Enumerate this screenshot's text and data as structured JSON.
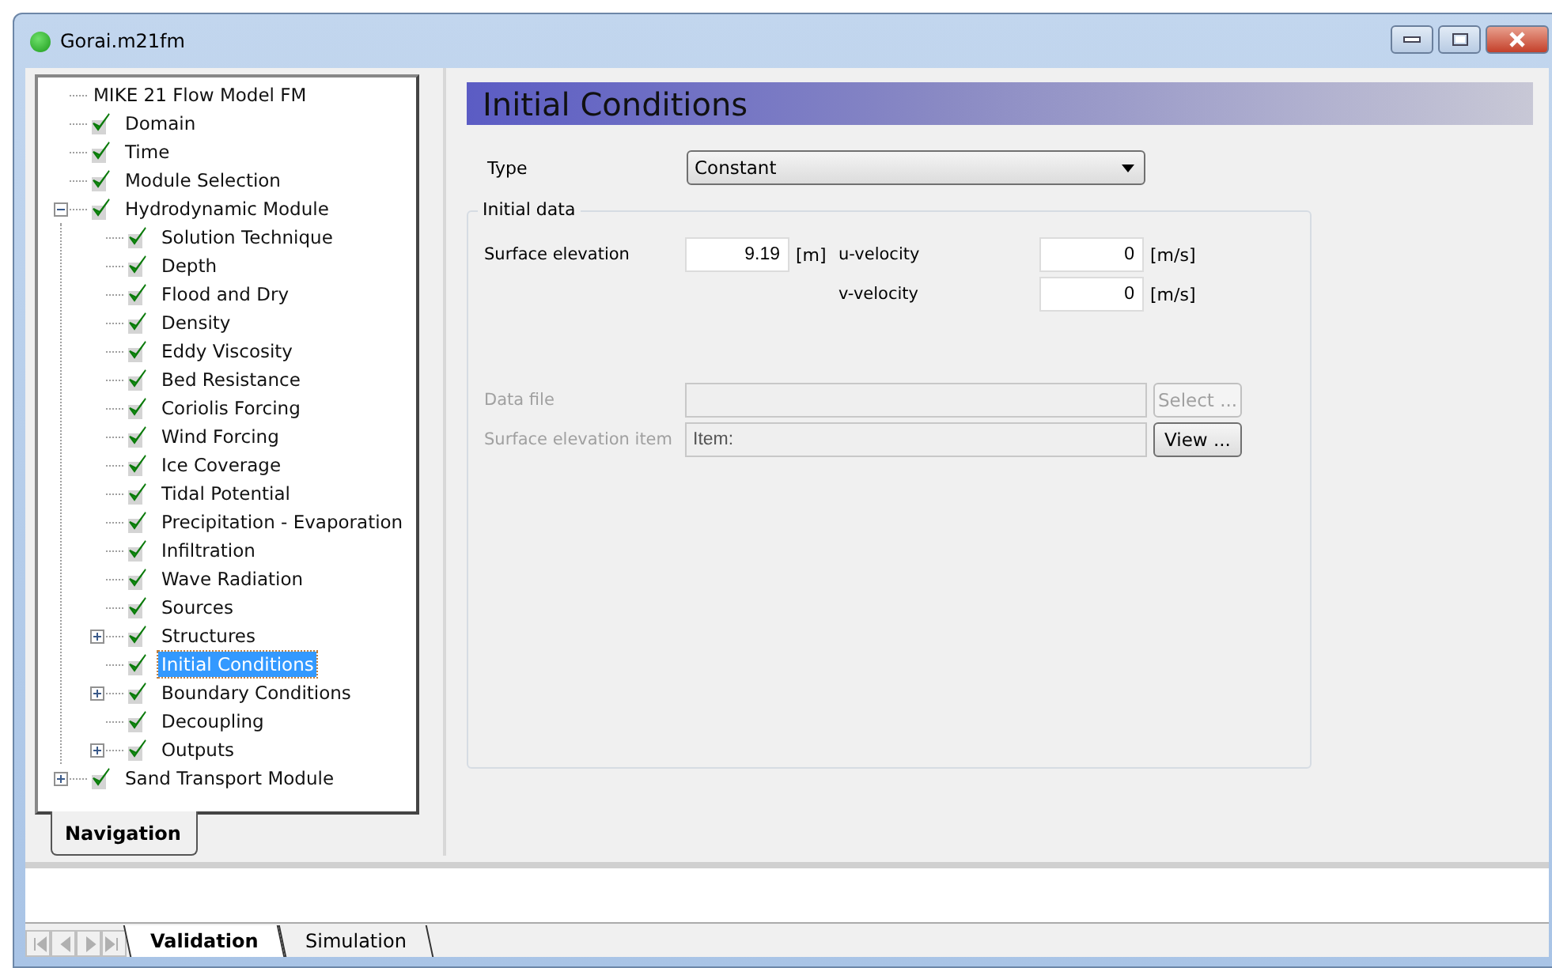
{
  "window": {
    "title": "Gorai.m21fm"
  },
  "tree": [
    {
      "label": "MIKE 21 Flow Model FM",
      "checked": false,
      "selected": false
    },
    {
      "label": "Domain",
      "checked": true,
      "selected": false
    },
    {
      "label": "Time",
      "checked": true,
      "selected": false
    },
    {
      "label": "Module Selection",
      "checked": true,
      "selected": false
    },
    {
      "label": "Hydrodynamic Module",
      "checked": true,
      "selected": false,
      "expanded": true,
      "children": [
        {
          "label": "Solution Technique",
          "checked": true,
          "selected": false
        },
        {
          "label": "Depth",
          "checked": true,
          "selected": false
        },
        {
          "label": "Flood and Dry",
          "checked": true,
          "selected": false
        },
        {
          "label": "Density",
          "checked": true,
          "selected": false
        },
        {
          "label": "Eddy Viscosity",
          "checked": true,
          "selected": false
        },
        {
          "label": "Bed Resistance",
          "checked": true,
          "selected": false
        },
        {
          "label": "Coriolis Forcing",
          "checked": true,
          "selected": false
        },
        {
          "label": "Wind Forcing",
          "checked": true,
          "selected": false
        },
        {
          "label": "Ice Coverage",
          "checked": true,
          "selected": false
        },
        {
          "label": "Tidal Potential",
          "checked": true,
          "selected": false
        },
        {
          "label": "Precipitation - Evaporation",
          "checked": true,
          "selected": false
        },
        {
          "label": "Infiltration",
          "checked": true,
          "selected": false
        },
        {
          "label": "Wave Radiation",
          "checked": true,
          "selected": false
        },
        {
          "label": "Sources",
          "checked": true,
          "selected": false
        },
        {
          "label": "Structures",
          "checked": true,
          "selected": false,
          "expanded": false
        },
        {
          "label": "Initial Conditions",
          "checked": true,
          "selected": true
        },
        {
          "label": "Boundary Conditions",
          "checked": true,
          "selected": false,
          "expanded": false
        },
        {
          "label": "Decoupling",
          "checked": true,
          "selected": false
        },
        {
          "label": "Outputs",
          "checked": true,
          "selected": false,
          "expanded": false
        }
      ]
    },
    {
      "label": "Sand Transport Module",
      "checked": true,
      "selected": false,
      "expanded": false
    }
  ],
  "left_tabs": [
    {
      "label": "Navigation",
      "selected": true
    }
  ],
  "page": {
    "title": "Initial Conditions",
    "type": {
      "label": "Type",
      "value": "Constant"
    },
    "group": {
      "title": "Initial data",
      "surface_elevation": {
        "label": "Surface elevation",
        "value": "9.19",
        "unit": "[m]"
      },
      "u_velocity": {
        "label": "u-velocity",
        "value": "0",
        "unit": "[m/s]"
      },
      "v_velocity": {
        "label": "v-velocity",
        "value": "0",
        "unit": "[m/s]"
      },
      "data_file": {
        "label": "Data file",
        "disabled": true,
        "button": {
          "label": "Select ...",
          "disabled": true
        }
      },
      "item": {
        "label": "Surface elevation item",
        "value": "Item:",
        "disabled": true,
        "button": {
          "label": "View ...",
          "disabled": false
        }
      }
    }
  },
  "bottom_tabs": [
    {
      "label": "Validation",
      "selected": true
    },
    {
      "label": "Simulation",
      "selected": false
    }
  ]
}
